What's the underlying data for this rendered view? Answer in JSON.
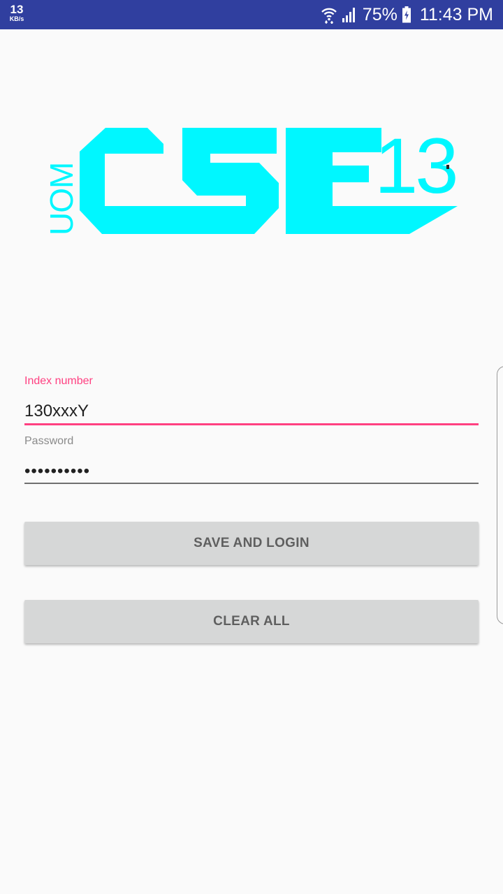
{
  "status_bar": {
    "net_speed_value": "13",
    "net_speed_unit": "KB/s",
    "battery_percent": "75%",
    "time": "11:43 PM",
    "background": "#303f9f"
  },
  "logo": {
    "side_text": "UOM",
    "main_text": "CSE",
    "superscript": "13",
    "color": "#00f7ff"
  },
  "form": {
    "index_label": "Index number",
    "index_value": "130xxxY",
    "password_label": "Password",
    "password_value": "••••••••••",
    "accent_color": "#ff4081"
  },
  "buttons": {
    "save_login": "SAVE AND LOGIN",
    "clear_all": "CLEAR ALL"
  },
  "icons": [
    "wifi-icon",
    "signal-icon",
    "battery-charging-icon"
  ]
}
